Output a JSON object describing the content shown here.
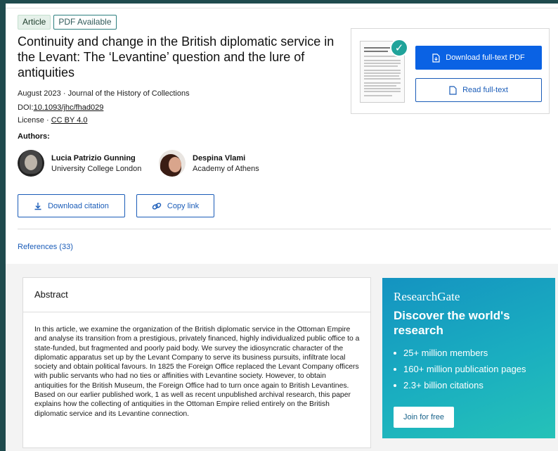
{
  "badges": {
    "article": "Article",
    "pdf": "PDF Available"
  },
  "title": "Continuity and change in the British diplomatic service in the Levant: The ‘Levantine’ question and the lure of antiquities",
  "meta": {
    "date": "August 2023",
    "separator": "·",
    "journal": "Journal of the History of Collections",
    "doi_label": "DOI:",
    "doi": "10.1093/jhc/fhad029",
    "license_label": "License",
    "license_sep": "·",
    "license": "CC BY 4.0"
  },
  "authors_heading": "Authors:",
  "authors": [
    {
      "name": "Lucia Patrizio Gunning",
      "affiliation": "University College London"
    },
    {
      "name": "Despina Vlami",
      "affiliation": "Academy of Athens"
    }
  ],
  "actions": {
    "download_citation": "Download citation",
    "copy_link": "Copy link"
  },
  "references": "References (33)",
  "pdf_card": {
    "download": "Download full-text PDF",
    "read": "Read full-text"
  },
  "abstract": {
    "title": "Abstract",
    "body": "In this article, we examine the organization of the British diplomatic service in the Ottoman Empire and analyse its transition from a prestigious, privately financed, highly individualized public office to a state-funded, but fragmented and poorly paid body. We survey the idiosyncratic character of the diplomatic apparatus set up by the Levant Company to serve its business pursuits, infiltrate local society and obtain political favours. In 1825 the Foreign Office replaced the Levant Company officers with public servants who had no ties or affinities with Levantine society. However, to obtain antiquities for the British Museum, the Foreign Office had to turn once again to British Levantines. Based on our earlier published work, 1 as well as recent unpublished archival research, this paper explains how the collecting of antiquities in the Ottoman Empire relied entirely on the British diplomatic service and its Levantine connection."
  },
  "researchgate": {
    "logo": "ResearchGate",
    "headline": "Discover the world's research",
    "items": [
      "25+ million members",
      "160+ million publication pages",
      "2.3+ billion citations"
    ],
    "join": "Join for free"
  },
  "colors": {
    "accent": "#0a62e4",
    "link": "#1a5cb8",
    "rg_gradient_start": "#1493c1",
    "rg_gradient_end": "#25c2b8",
    "check": "#20a39a"
  }
}
